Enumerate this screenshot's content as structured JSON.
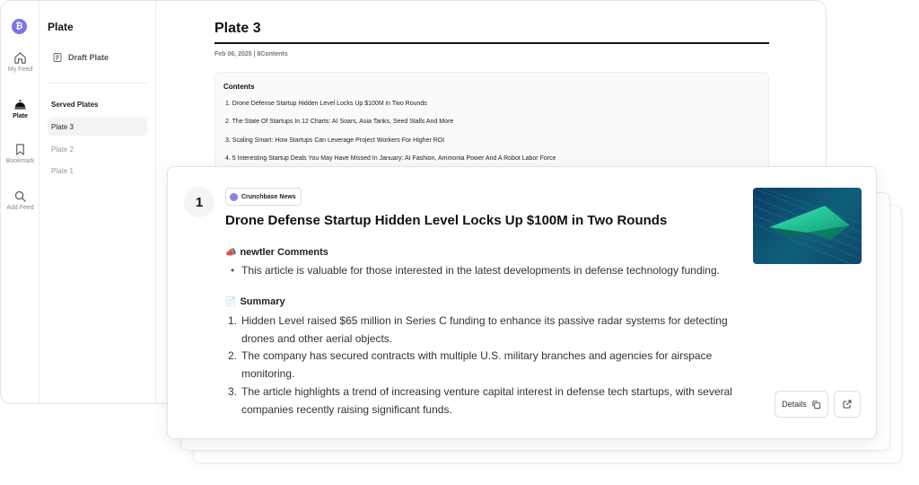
{
  "nav": {
    "logo_glyph": "₿",
    "items": [
      {
        "label": "My Feed",
        "icon": "home-icon"
      },
      {
        "label": "Plate",
        "icon": "cloche-icon"
      },
      {
        "label": "Bookmark",
        "icon": "bookmark-icon"
      },
      {
        "label": "Add Feed",
        "icon": "search-icon"
      }
    ],
    "active": "Plate"
  },
  "sidebar": {
    "title": "Plate",
    "draft_label": "Draft Plate",
    "served_heading": "Served Plates",
    "plates": [
      {
        "label": "Plate 3",
        "active": true
      },
      {
        "label": "Plate 2",
        "active": false
      },
      {
        "label": "Plate 1",
        "active": false
      }
    ]
  },
  "main": {
    "title": "Plate 3",
    "meta": "Feb 06, 2025 | 8Contents",
    "contents_heading": "Contents",
    "contents": [
      "1. Drone Defense Startup Hidden Level Locks Up $100M in Two Rounds",
      "2. The State Of Startups In 12 Charts: AI Soars, Asia Tanks, Seed Stalls And More",
      "3. Scaling Smart: How Startups Can Leverage Project Workers For Higher ROI",
      "4. 5 Interesting Startup Deals You May Have Missed In January: AI Fashion, Ammonia Power And A Robot Labor Force"
    ]
  },
  "card": {
    "number": "1",
    "source": "Crunchbase News",
    "title": "Drone Defense Startup Hidden Level Locks Up $100M in Two Rounds",
    "comments_heading": "newtler Comments",
    "comments_icon": "📣",
    "comments": [
      "This article is valuable for those interested in the latest developments in defense technology funding."
    ],
    "summary_heading": "Summary",
    "summary_icon": "📄",
    "summary": [
      {
        "num": "1.",
        "text": "Hidden Level raised $65 million in Series C funding to enhance its passive radar systems for detecting drones and other aerial objects."
      },
      {
        "num": "2.",
        "text": "The company has secured contracts with multiple U.S. military branches and agencies for airspace monitoring."
      },
      {
        "num": "3.",
        "text": "The article highlights a trend of increasing venture capital interest in defense tech startups, with several companies recently raising significant funds."
      }
    ],
    "details_label": "Details"
  },
  "colors": {
    "accent": "#7b74e6",
    "thumbnail_primary": "#0e5f7a",
    "thumbnail_highlight": "#2ee6a8"
  }
}
